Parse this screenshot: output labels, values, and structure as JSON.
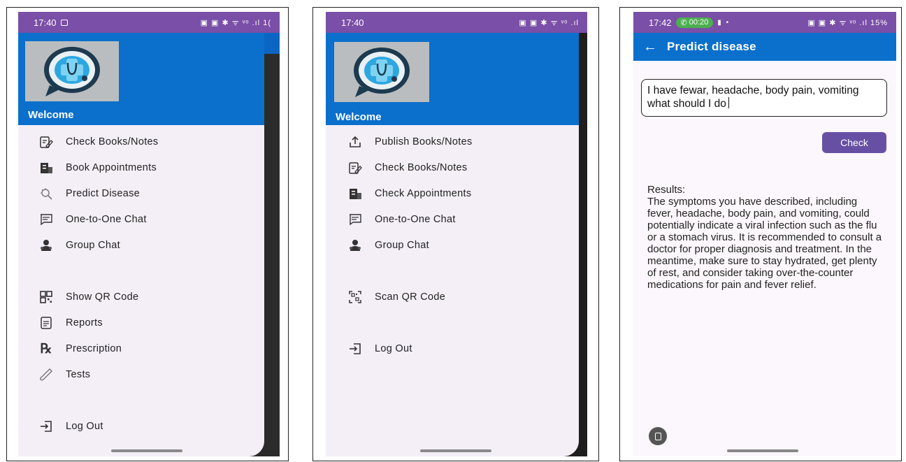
{
  "colors": {
    "status_bar": "#7a4fa7",
    "header_blue": "#0b6fcc",
    "drawer_bg": "#f4eff7",
    "check_button": "#6750a4"
  },
  "screen1": {
    "status_time": "17:40",
    "status_right": "▣ ▣ ✱ ᯤ ᵛᵒ .ıl 1(",
    "welcome": "Welcome",
    "menu": [
      {
        "label": "Check Books/Notes",
        "icon": "notes-edit-icon"
      },
      {
        "label": "Book Appointments",
        "icon": "hospital-icon"
      },
      {
        "label": "Predict Disease",
        "icon": "virus-search-icon"
      },
      {
        "label": "One-to-One Chat",
        "icon": "chat-icon"
      },
      {
        "label": "Group Chat",
        "icon": "group-icon"
      },
      {
        "label": "Show QR Code",
        "icon": "qr-code-icon"
      },
      {
        "label": "Reports",
        "icon": "report-icon"
      },
      {
        "label": "Prescription",
        "icon": "prescription-icon"
      },
      {
        "label": "Tests",
        "icon": "test-tube-icon"
      },
      {
        "label": "Log Out",
        "icon": "logout-icon"
      }
    ]
  },
  "screen2": {
    "status_time": "17:40",
    "status_right": "▣ ▣ ✱ ᯤ ᵛᵒ .ıl",
    "welcome": "Welcome",
    "menu": [
      {
        "label": "Publish Books/Notes",
        "icon": "upload-icon"
      },
      {
        "label": "Check Books/Notes",
        "icon": "notes-edit-icon"
      },
      {
        "label": "Check Appointments",
        "icon": "hospital-icon"
      },
      {
        "label": "One-to-One Chat",
        "icon": "chat-icon"
      },
      {
        "label": "Group Chat",
        "icon": "group-icon"
      },
      {
        "label": "Scan QR Code",
        "icon": "qr-scan-icon"
      },
      {
        "label": "Log Out",
        "icon": "logout-icon"
      }
    ]
  },
  "screen3": {
    "status_time": "17:42",
    "call_timer": "00:20",
    "status_right": "▣ ▣ ✱ ᯤ ᵛᵒ .ıl 15%",
    "title": "Predict disease",
    "input_value": "I have fewar, headache, body pain, vomiting what should I do",
    "check_label": "Check",
    "results_label": "Results:",
    "results_text": "The symptoms you have described, including fever, headache, body pain, and vomiting, could potentially indicate a viral infection such as the flu or a stomach virus. It is recommended to consult a doctor for proper diagnosis and treatment. In the meantime, make sure to stay hydrated, get plenty of rest, and consider taking over-the-counter medications for pain and fever relief."
  }
}
